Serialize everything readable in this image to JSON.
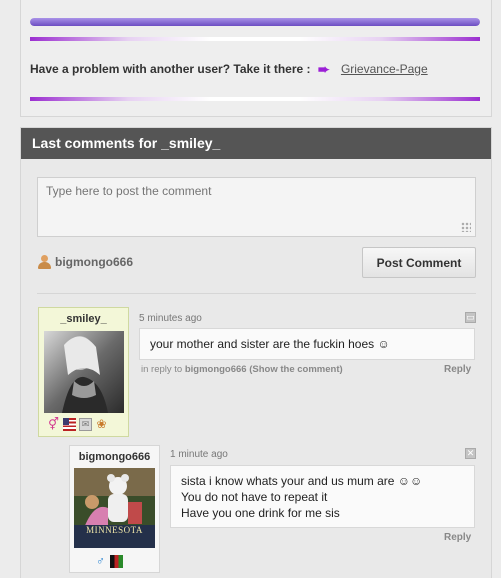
{
  "top": {
    "progress_fraction": 1.0,
    "problem_text": "Have a problem with another user? Take it there :",
    "arrow_icon": "arrow-right-icon",
    "grievance_link": "Grievance-Page",
    "accent_color": "#9b2fd0"
  },
  "comments": {
    "header_title": "Last comments for _smiley_",
    "input_placeholder": "Type here to post the comment",
    "current_user": "bigmongo666",
    "post_button": "Post Comment",
    "items": [
      {
        "author": "_smiley_",
        "time": "5 minutes ago",
        "text": "your mother and sister are the fuckin hoes ☺",
        "meta_prefix": "in reply to",
        "meta_user": "bigmongo666",
        "meta_link": "(Show the comment)",
        "reply": "Reply",
        "icons": [
          "gender-female-male-icon",
          "us-flag-icon",
          "mail-icon",
          "pet-icon"
        ]
      },
      {
        "author": "bigmongo666",
        "time": "1 minute ago",
        "lines": [
          "sista i know whats your and us mum are ☺☺",
          "You do not have to repeat it",
          "Have you one drink for me sis"
        ],
        "avatar_caption": "MINNESOTA",
        "reply": "Reply",
        "icons": [
          "gender-male-icon",
          "afghanistan-flag-icon"
        ]
      }
    ]
  }
}
